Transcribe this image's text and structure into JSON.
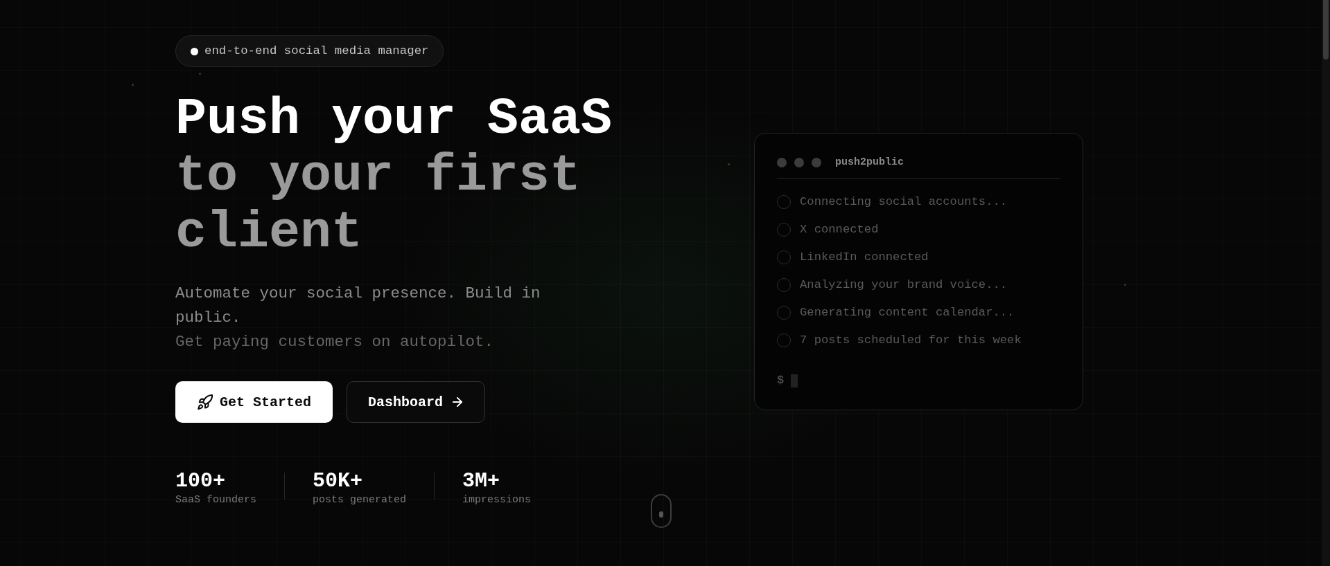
{
  "badge": {
    "text": "end-to-end social media manager"
  },
  "headline": {
    "lead": "Push your SaaS",
    "tail": "to your first client"
  },
  "subtitle": {
    "text": "Automate your social presence. Build in public.",
    "note": "Get paying customers on autopilot."
  },
  "buttons": [
    {
      "label": "Get Started",
      "kind": "primary"
    },
    {
      "label": "Dashboard",
      "kind": "secondary"
    }
  ],
  "stats": [
    {
      "value": "100+",
      "label": "SaaS founders"
    },
    {
      "value": "50K+",
      "label": "posts generated"
    },
    {
      "value": "3M+",
      "label": "impressions"
    }
  ],
  "terminal": {
    "title": "push2public",
    "steps": [
      {
        "text": "Connecting social accounts...",
        "done": false
      },
      {
        "text": "X connected",
        "done": false
      },
      {
        "text": "LinkedIn connected",
        "done": false
      },
      {
        "text": "Analyzing your brand voice...",
        "done": false
      },
      {
        "text": "Generating content calendar...",
        "done": false
      },
      {
        "text": "7 posts scheduled for this week",
        "done": false
      }
    ],
    "prompt": "$"
  }
}
